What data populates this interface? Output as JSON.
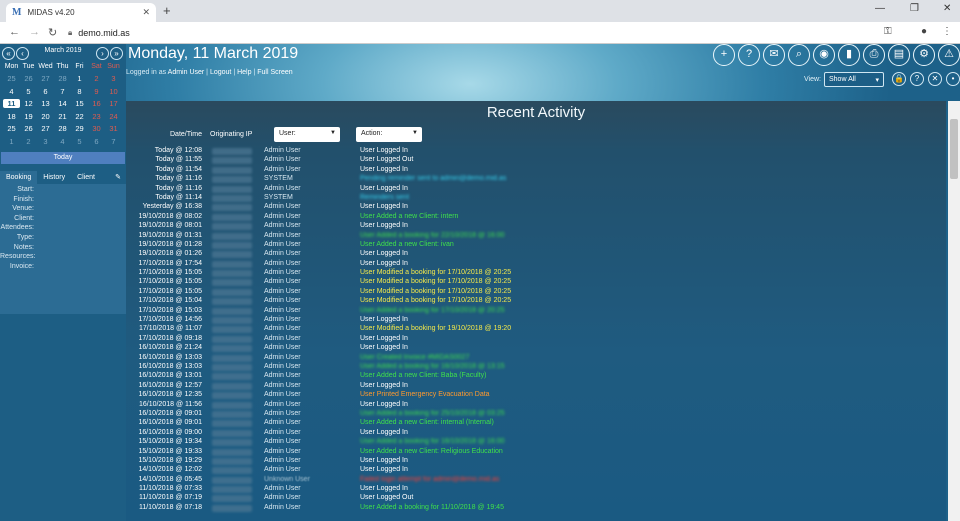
{
  "browser": {
    "tab_title": "MIDAS v4.20",
    "favicon": "M",
    "url": "demo.mid.as",
    "new_tab": "+",
    "nav": {
      "back": "←",
      "forward": "→",
      "reload": "↻"
    },
    "window": {
      "minimize": "—",
      "restore": "❐",
      "close": "✕"
    }
  },
  "calendar": {
    "month": "March 2019",
    "prev_year": "«",
    "prev_month": "‹",
    "next_month": "›",
    "next_year": "»",
    "dows": [
      "Mon",
      "Tue",
      "Wed",
      "Thu",
      "Fri",
      "Sat",
      "Sun"
    ],
    "weeks": [
      [
        "25",
        "26",
        "27",
        "28",
        "1",
        "2",
        "3"
      ],
      [
        "4",
        "5",
        "6",
        "7",
        "8",
        "9",
        "10"
      ],
      [
        "11",
        "12",
        "13",
        "14",
        "15",
        "16",
        "17"
      ],
      [
        "18",
        "19",
        "20",
        "21",
        "22",
        "23",
        "24"
      ],
      [
        "25",
        "26",
        "27",
        "28",
        "29",
        "30",
        "31"
      ],
      [
        "1",
        "2",
        "3",
        "4",
        "5",
        "6",
        "7"
      ]
    ],
    "today_button": "Today"
  },
  "side_tabs": [
    "Booking",
    "History",
    "Client"
  ],
  "side_pin": "✎",
  "details_labels": [
    "Start:",
    "Finish:",
    "Venue:",
    "Client:",
    "Attendees:",
    "Type:",
    "Notes:",
    "Resources:",
    "Invoice:"
  ],
  "header": {
    "date_title": "Monday, 11 March 2019",
    "logged_in_prefix": "Logged in as",
    "user": "Admin User",
    "links": [
      "Logout",
      "Help",
      "Full Screen"
    ],
    "view_label": "View:",
    "view_value": "Show All"
  },
  "toolbar_icons": [
    {
      "name": "add-icon",
      "glyph": "+"
    },
    {
      "name": "help-icon",
      "glyph": "?"
    },
    {
      "name": "mail-icon",
      "glyph": "✉"
    },
    {
      "name": "search-icon",
      "glyph": "⌕"
    },
    {
      "name": "view-icon",
      "glyph": "◉"
    },
    {
      "name": "stats-icon",
      "glyph": "▮"
    },
    {
      "name": "print-icon",
      "glyph": "⎙"
    },
    {
      "name": "document-icon",
      "glyph": "▤"
    },
    {
      "name": "settings-icon",
      "glyph": "⚙"
    },
    {
      "name": "alert-icon",
      "glyph": "⚠"
    }
  ],
  "small_icons": [
    {
      "name": "lock-icon",
      "glyph": "🔒"
    },
    {
      "name": "info-icon",
      "glyph": "?"
    },
    {
      "name": "close-icon",
      "glyph": "✕"
    },
    {
      "name": "dot-icon",
      "glyph": "•"
    }
  ],
  "activity": {
    "title": "Recent Activity",
    "col_datetime": "Date/Time",
    "col_ip": "Originating IP",
    "user_filter": "User:",
    "action_filter": "Action:",
    "colors": {
      "white": "#ffffff",
      "green": "#3fe04a",
      "yellow": "#f5e94a",
      "cyan": "#37d3f0",
      "orange": "#ff9a2e",
      "red": "#ff3b30"
    },
    "rows": [
      {
        "date": "Today @ 12:08",
        "user": "Admin User",
        "action": "User Logged In",
        "color": "white"
      },
      {
        "date": "Today @ 11:55",
        "user": "Admin User",
        "action": "User Logged Out",
        "color": "white"
      },
      {
        "date": "Today @ 11:54",
        "user": "Admin User",
        "action": "User Logged In",
        "color": "white"
      },
      {
        "date": "Today @ 11:16",
        "user": "SYSTEM",
        "action": "Pending reminder sent to admin@demo.mid.as",
        "color": "cyan",
        "blur": true
      },
      {
        "date": "Today @ 11:16",
        "user": "Admin User",
        "action": "User Logged In",
        "color": "white"
      },
      {
        "date": "Today @ 11:14",
        "user": "SYSTEM",
        "action": "Reminders sent",
        "color": "cyan",
        "blur": true
      },
      {
        "date": "Yesterday @ 16:38",
        "user": "Admin User",
        "action": "User Logged In",
        "color": "white"
      },
      {
        "date": "19/10/2018 @ 08:02",
        "user": "Admin User",
        "action": "User Added a new Client: intern",
        "color": "green"
      },
      {
        "date": "19/10/2018 @ 08:01",
        "user": "Admin User",
        "action": "User Logged In",
        "color": "white"
      },
      {
        "date": "19/10/2018 @ 01:31",
        "user": "Admin User",
        "action": "User Added a booking for 22/10/2018 @ 16:00",
        "color": "green",
        "blur": true
      },
      {
        "date": "19/10/2018 @ 01:28",
        "user": "Admin User",
        "action": "User Added a new Client: ivan",
        "color": "green"
      },
      {
        "date": "19/10/2018 @ 01:26",
        "user": "Admin User",
        "action": "User Logged In",
        "color": "white"
      },
      {
        "date": "17/10/2018 @ 17:54",
        "user": "Admin User",
        "action": "User Logged In",
        "color": "white"
      },
      {
        "date": "17/10/2018 @ 15:05",
        "user": "Admin User",
        "action": "User Modified a booking for 17/10/2018 @ 20:25",
        "color": "yellow"
      },
      {
        "date": "17/10/2018 @ 15:05",
        "user": "Admin User",
        "action": "User Modified a booking for 17/10/2018 @ 20:25",
        "color": "yellow"
      },
      {
        "date": "17/10/2018 @ 15:05",
        "user": "Admin User",
        "action": "User Modified a booking for 17/10/2018 @ 20:25",
        "color": "yellow"
      },
      {
        "date": "17/10/2018 @ 15:04",
        "user": "Admin User",
        "action": "User Modified a booking for 17/10/2018 @ 20:25",
        "color": "yellow"
      },
      {
        "date": "17/10/2018 @ 15:03",
        "user": "Admin User",
        "action": "User Added a booking for 17/10/2018 @ 20:25",
        "color": "green",
        "blur": true
      },
      {
        "date": "17/10/2018 @ 14:56",
        "user": "Admin User",
        "action": "User Logged In",
        "color": "white"
      },
      {
        "date": "17/10/2018 @ 11:07",
        "user": "Admin User",
        "action": "User Modified a booking for 19/10/2018 @ 19:20",
        "color": "yellow"
      },
      {
        "date": "17/10/2018 @ 09:18",
        "user": "Admin User",
        "action": "User Logged In",
        "color": "white"
      },
      {
        "date": "16/10/2018 @ 21:24",
        "user": "Admin User",
        "action": "User Logged In",
        "color": "white"
      },
      {
        "date": "16/10/2018 @ 13:03",
        "user": "Admin User",
        "action": "User Created Invoice #MIDAS0027",
        "color": "green",
        "blur": true
      },
      {
        "date": "16/10/2018 @ 13:03",
        "user": "Admin User",
        "action": "User Added a booking for 16/10/2018 @ 13:15",
        "color": "green",
        "blur": true
      },
      {
        "date": "16/10/2018 @ 13:01",
        "user": "Admin User",
        "action": "User Added a new Client: Baba (Faculty)",
        "color": "green"
      },
      {
        "date": "16/10/2018 @ 12:57",
        "user": "Admin User",
        "action": "User Logged In",
        "color": "white"
      },
      {
        "date": "16/10/2018 @ 12:35",
        "user": "Admin User",
        "action": "User Printed Emergency Evacuation Data",
        "color": "orange"
      },
      {
        "date": "16/10/2018 @ 11:56",
        "user": "Admin User",
        "action": "User Logged In",
        "color": "white"
      },
      {
        "date": "16/10/2018 @ 09:01",
        "user": "Admin User",
        "action": "User Added a booking for 25/10/2018 @ 03:25",
        "color": "green",
        "blur": true
      },
      {
        "date": "16/10/2018 @ 09:01",
        "user": "Admin User",
        "action": "User Added a new Client: internal (Internal)",
        "color": "green"
      },
      {
        "date": "16/10/2018 @ 09:00",
        "user": "Admin User",
        "action": "User Logged In",
        "color": "white"
      },
      {
        "date": "15/10/2018 @ 19:34",
        "user": "Admin User",
        "action": "User Added a booking for 16/10/2018 @ 16:00",
        "color": "green",
        "blur": true
      },
      {
        "date": "15/10/2018 @ 19:33",
        "user": "Admin User",
        "action": "User Added a new Client: Religious Education",
        "color": "green"
      },
      {
        "date": "15/10/2018 @ 19:29",
        "user": "Admin User",
        "action": "User Logged In",
        "color": "white"
      },
      {
        "date": "14/10/2018 @ 12:02",
        "user": "Admin User",
        "action": "User Logged In",
        "color": "white"
      },
      {
        "date": "14/10/2018 @ 05:45",
        "user": "Unknown User",
        "action": "Failed login attempt for admin@demo.mid.as",
        "color": "red",
        "blur": true,
        "userblur": true
      },
      {
        "date": "11/10/2018 @ 07:33",
        "user": "Admin User",
        "action": "User Logged In",
        "color": "white"
      },
      {
        "date": "11/10/2018 @ 07:19",
        "user": "Admin User",
        "action": "User Logged Out",
        "color": "white"
      },
      {
        "date": "11/10/2018 @ 07:18",
        "user": "Admin User",
        "action": "User Added a booking for 11/10/2018 @ 19:45",
        "color": "green"
      }
    ]
  }
}
